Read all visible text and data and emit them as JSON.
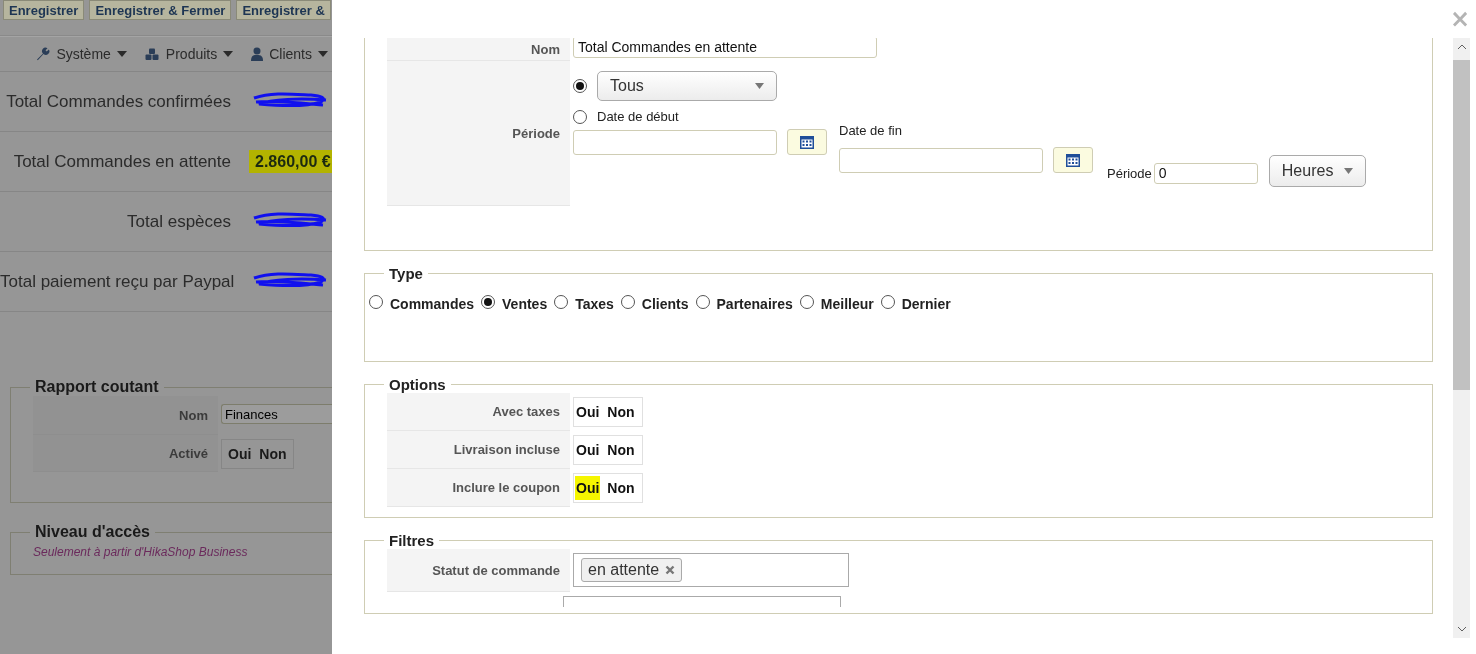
{
  "background": {
    "toolbar": [
      "Enregistrer",
      "Enregistrer & Fermer",
      "Enregistrer &"
    ],
    "menu": [
      {
        "label": "Système"
      },
      {
        "label": "Produits"
      },
      {
        "label": "Clients"
      }
    ],
    "stats": [
      {
        "label": "Total Commandes confirmées",
        "redacted": true
      },
      {
        "label": "Total Commandes en attente",
        "redacted": false,
        "value": "2.860,00 €",
        "highlighted": true
      },
      {
        "label": "Total espèces",
        "redacted": true
      },
      {
        "label": "Total paiement reçu par Paypal",
        "redacted": true
      }
    ],
    "report": {
      "legend": "Rapport coutant",
      "fields": [
        {
          "label": "Nom",
          "kind": "text",
          "value": "Finances"
        },
        {
          "label": "Activé",
          "kind": "toggle",
          "choices": [
            "Oui",
            "Non"
          ]
        }
      ]
    },
    "access": {
      "legend": "Niveau d'accès",
      "note": "Seulement à partir d'HikaShop Business"
    }
  },
  "modal": {
    "close": "×",
    "name": {
      "label": "Nom",
      "value": "Total Commandes en attente"
    },
    "period": {
      "label": "Période",
      "preset": {
        "selected": true,
        "value": "Tous"
      },
      "custom": {
        "selected": false,
        "label": "Date de début"
      },
      "end_label": "Date de fin",
      "offset_label": "Période",
      "offset_value": "0",
      "unit": "Heures"
    },
    "type": {
      "legend": "Type",
      "options": [
        {
          "label": "Commandes",
          "selected": false
        },
        {
          "label": "Ventes",
          "selected": true
        },
        {
          "label": "Taxes",
          "selected": false
        },
        {
          "label": "Clients",
          "selected": false
        },
        {
          "label": "Partenaires",
          "selected": false
        },
        {
          "label": "Meilleur",
          "selected": false
        },
        {
          "label": "Dernier",
          "selected": false
        }
      ]
    },
    "options": {
      "legend": "Options",
      "rows": [
        {
          "label": "Avec taxes",
          "choices": [
            {
              "label": "Oui",
              "highlighted": false
            },
            {
              "label": "Non",
              "highlighted": false
            }
          ]
        },
        {
          "label": "Livraison incluse",
          "choices": [
            {
              "label": "Oui",
              "highlighted": false
            },
            {
              "label": "Non",
              "highlighted": false
            }
          ]
        },
        {
          "label": "Inclure le coupon",
          "choices": [
            {
              "label": "Oui",
              "highlighted": true
            },
            {
              "label": "Non",
              "highlighted": false
            }
          ]
        }
      ]
    },
    "filters": {
      "legend": "Filtres",
      "rows": [
        {
          "label": "Statut de commande",
          "tags": [
            "en attente"
          ]
        }
      ]
    }
  }
}
